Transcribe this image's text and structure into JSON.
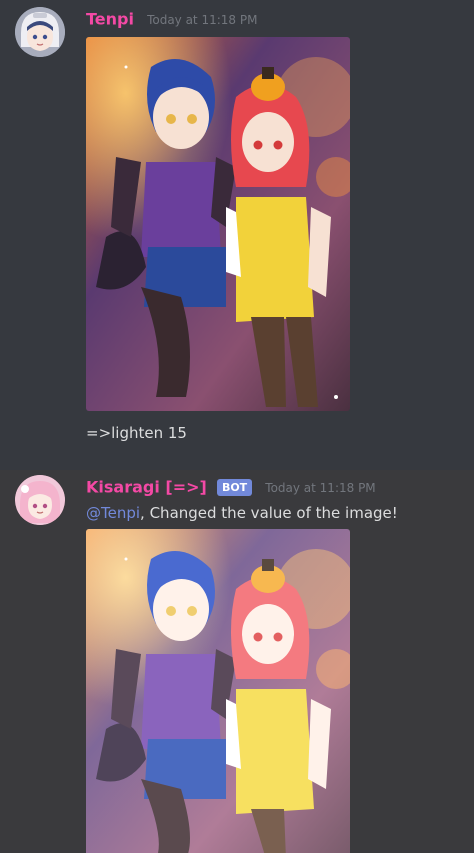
{
  "messages": [
    {
      "author": "Tenpi",
      "timestamp": "Today at 11:18 PM",
      "content": "=>lighten 15",
      "author_color": "#f449a5",
      "avatar_icon": "white-hooded-anime-girl-avatar",
      "attachment": "anime-halloween-illustration-two-girls"
    },
    {
      "author": "Kisaragi [=>]",
      "bot_tag": "BOT",
      "timestamp": "Today at 11:18 PM",
      "mention": "@Tenpi",
      "content": ", Changed the value of the image!",
      "author_color": "#f449a5",
      "avatar_icon": "pink-haired-anime-girl-avatar",
      "attachment": "anime-halloween-illustration-two-girls-lightened"
    }
  ]
}
